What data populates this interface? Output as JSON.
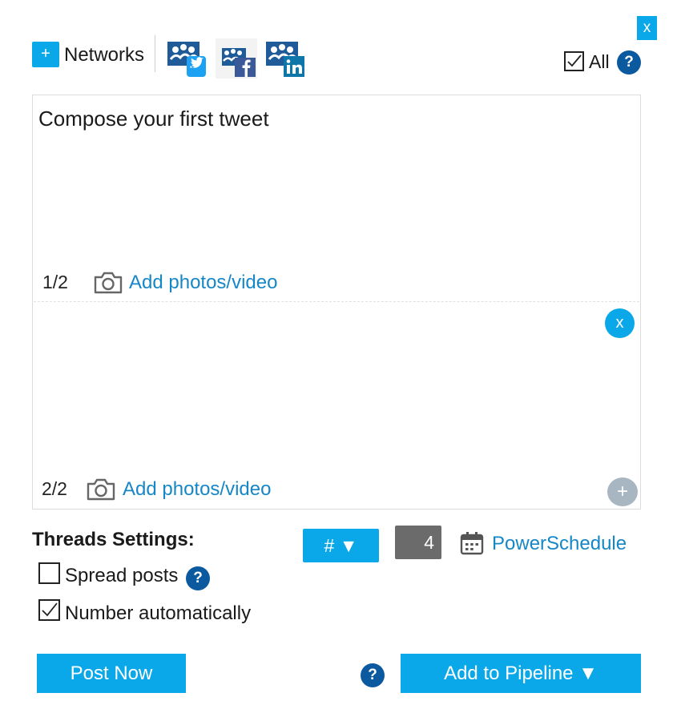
{
  "header": {
    "close_label": "x",
    "add_label": "+",
    "networks_label": "Networks",
    "networks": [
      {
        "icon": "twitter-badge-icon",
        "color": "#1da1f2"
      },
      {
        "icon": "facebook-badge-icon",
        "color": "#3b5998"
      },
      {
        "icon": "linkedin-badge-icon",
        "color": "#0e76a8"
      }
    ],
    "all_label": "All",
    "all_checked": true,
    "help_label": "?"
  },
  "composer": {
    "posts": [
      {
        "text": "Compose your first tweet",
        "counter": "1/2",
        "media_label": "Add photos/video"
      },
      {
        "text": "",
        "counter": "2/2",
        "media_label": "Add photos/video",
        "remove_label": "x",
        "add_label": "+"
      }
    ]
  },
  "threads": {
    "heading": "Threads Settings:",
    "spread_label": "Spread posts",
    "spread_checked": false,
    "spread_help": "?",
    "number_label": "Number automatically",
    "number_checked": true,
    "hash_label": "# ▼",
    "number_value": "4",
    "power_label": "PowerSchedule"
  },
  "footer": {
    "post_now_label": "Post Now",
    "help_label": "?",
    "pipeline_label": "Add to Pipeline ▼"
  },
  "colors": {
    "accent": "#0aa8e8",
    "help": "#0b5aa0",
    "link": "#1687c6",
    "disabled": "#a8b6c2"
  }
}
